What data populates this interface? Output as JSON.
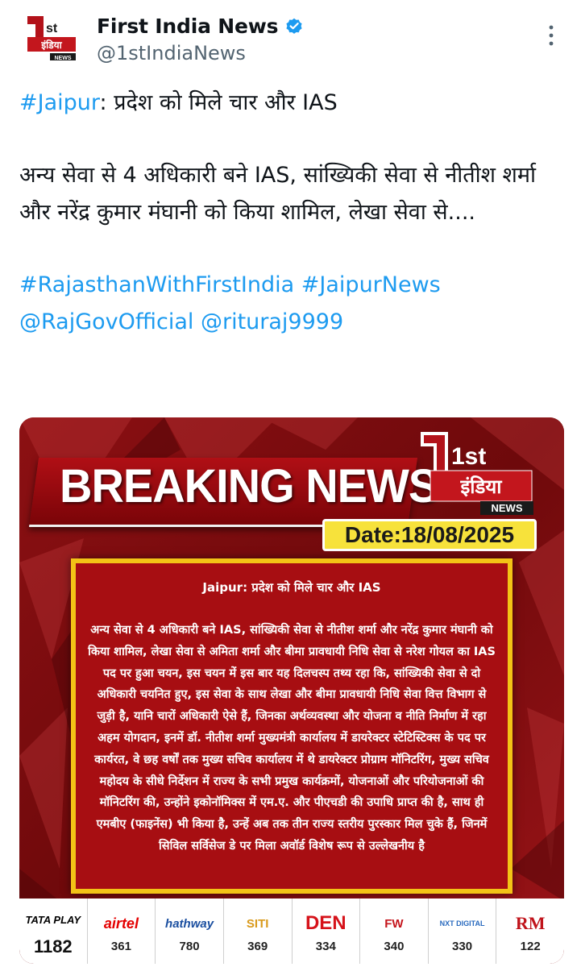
{
  "header": {
    "display_name": "First India News",
    "handle": "@1stIndiaNews",
    "avatar_logo": "1st इंडिया NEWS"
  },
  "tweet": {
    "line1_hashtag": "#Jaipur",
    "line1_text": ": प्रदेश को मिले चार और IAS",
    "para2": "अन्य सेवा से 4 अधिकारी बने IAS, सांख्यिकी सेवा से नीतीश शर्मा और नरेंद्र कुमार मंघानी को किया शामिल, लेखा सेवा से....",
    "hashtag1": "#RajasthanWithFirstIndia",
    "hashtag2": "#JaipurNews",
    "mention1": "@RajGovOfficial",
    "mention2": "@rituraj9999"
  },
  "media": {
    "banner_text": "BREAKING NEWS",
    "logo_1st": "1st",
    "logo_india": "इंडिया",
    "logo_news": "NEWS",
    "date": "Date:18/08/2025",
    "news_title": "Jaipur: प्रदेश को मिले चार और IAS",
    "news_body": "अन्य सेवा से 4 अधिकारी बने IAS, सांख्यिकी सेवा से नीतीश शर्मा और नरेंद्र कुमार मंघानी को किया शामिल, लेखा सेवा से अमिता शर्मा और बीमा प्रावधायी निधि सेवा से नरेश गोयल का IAS पद पर हुआ चयन, इस चयन में इस बार यह दिलचस्प तथ्य रहा कि, सांख्यिकी सेवा से दो अधिकारी चयनित हुए, इस सेवा के साथ लेखा और बीमा प्रावधायी निधि सेवा वित्त विभाग से जुड़ी है, यानि चारों अधिकारी ऐसे हैं, जिनका अर्थव्यवस्था और योजना व नीति निर्माण में रहा अहम योगदान, इनमें डॉ. नीतीश शर्मा मुख्यमंत्री कार्यालय में डायरेक्टर स्टेटिस्टिक्स के पद पर कार्यरत, वे छह वर्षों तक मुख्य सचिव कार्यालय में थे डायरेक्टर प्रोग्राम मॉनिटरिंग, मुख्य सचिव महोदय के सीधे निर्देशन में राज्य के सभी प्रमुख कार्यक्रमों, योजनाओं और परियोजनाओं की मॉनिटरिंग की, उन्होंने इकोनॉमिक्स में एम.ए. और पीएचडी की उपाधि प्राप्त की है, साथ ही एमबीए (फाइनेंस) भी किया है, उन्हें अब तक तीन राज्य स्तरीय पुरस्कार मिल चुके हैं, जिनमें सिविल सर्विसेज डे पर मिला अवॉर्ड विशेष रूप से उल्लेखनीय है",
    "channels": [
      {
        "name": "TATA PLAY",
        "number": "1182",
        "color": "#000000"
      },
      {
        "name": "airtel",
        "number": "361",
        "color": "#e40000"
      },
      {
        "name": "hathway",
        "number": "780",
        "color": "#1b4fa0"
      },
      {
        "name": "SITI",
        "number": "369",
        "color": "#d99a1c"
      },
      {
        "name": "DEN",
        "number": "334",
        "color": "#d6121a"
      },
      {
        "name": "FW",
        "number": "340",
        "color": "#c5161d"
      },
      {
        "name": "NXT DIGITAL",
        "number": "330",
        "color": "#2a6bbf"
      },
      {
        "name": "RM",
        "number": "122",
        "color": "#c0141c"
      }
    ]
  },
  "colors": {
    "link": "#1d9bf0",
    "text": "#0f1419",
    "muted": "#536471",
    "verified": "#1d9bf0",
    "news_box": "#a70e12",
    "news_border": "#f3c316",
    "date_badge": "#f7e23b"
  },
  "icons": [
    "verified-badge-icon",
    "more-icon"
  ]
}
